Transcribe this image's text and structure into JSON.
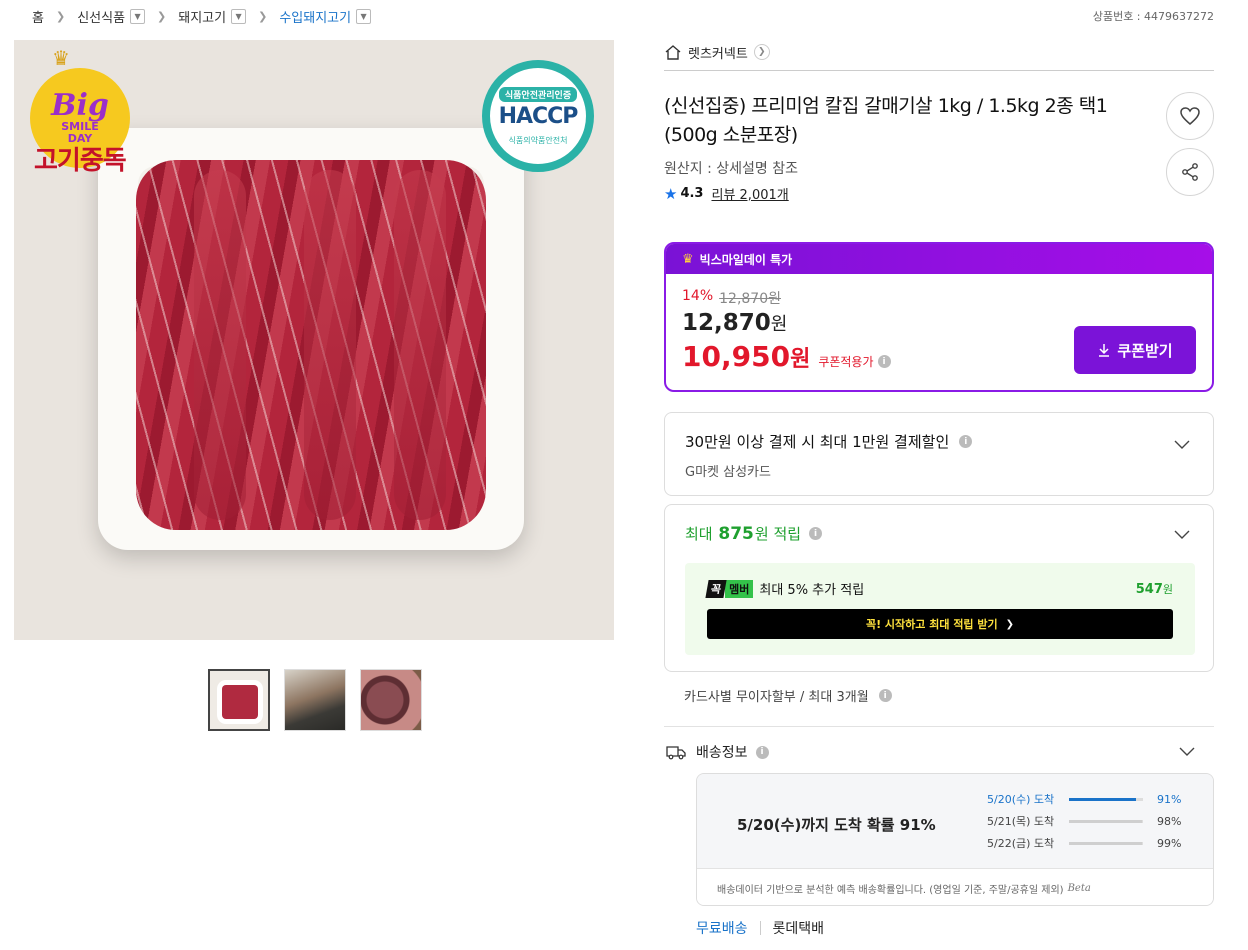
{
  "breadcrumb": {
    "items": [
      {
        "label": "홈"
      },
      {
        "label": "신선식품"
      },
      {
        "label": "돼지고기"
      },
      {
        "label": "수입돼지고기"
      }
    ]
  },
  "product_no": "상품번호 : 4479637272",
  "image": {
    "logo_big": "Big",
    "logo_smile": "SMILE",
    "logo_day": "DAY",
    "logo_brand": "고기중독",
    "haccp_top": "식품안전관리인증",
    "haccp_mid": "HACCP",
    "haccp_bottom": "식품의약품안전처"
  },
  "thumbnails": [
    "thumb-1",
    "thumb-2",
    "thumb-3"
  ],
  "store": {
    "name": "렛츠커넥트"
  },
  "product": {
    "title": "(신선집중) 프리미엄 칼집 갈매기살 1kg / 1.5kg 2종 택1 (500g 소분포장)",
    "origin": "원산지 : 상세설명 참조",
    "rating": "4.3",
    "review_label": "리뷰 2,001개"
  },
  "price": {
    "promo_label": "빅스마일데이 특가",
    "discount_pct": "14%",
    "original": "12,870원",
    "sale_amount": "12,870",
    "sale_unit": "원",
    "coupon_amount": "10,950",
    "coupon_unit": "원",
    "coupon_note": "쿠폰적용가",
    "coupon_button": "쿠폰받기"
  },
  "card_benefit": {
    "title": "30만원 이상 결제 시 최대 1만원 결제할인",
    "subtitle": "G마켓 삼성카드"
  },
  "points": {
    "prefix": "최대",
    "amount": "875",
    "suffix": "원 적립",
    "member_badge_1": "꼭",
    "member_badge_2": "멤버",
    "member_text": "최대 5% 추가 적립",
    "member_amount": "547",
    "member_unit": "원",
    "member_cta": "꼭! 시작하고 최대 적립 받기"
  },
  "installment": "카드사별 무이자할부 / 최대 3개월",
  "shipping": {
    "title": "배송정보",
    "probability_text": "5/20(수)까지 도착 확률 91%",
    "dates": [
      {
        "date": "5/20(수) 도착",
        "pct": "91%",
        "value": 91
      },
      {
        "date": "5/21(목) 도착",
        "pct": "98%",
        "value": 98
      },
      {
        "date": "5/22(금) 도착",
        "pct": "99%",
        "value": 99
      }
    ],
    "note": "배송데이터 기반으로 분석한 예측 배송확률입니다. (영업일 기준, 주말/공휴일 제외)",
    "beta": "Beta",
    "free": "무료배송",
    "carrier": "롯데택배"
  },
  "colors": {
    "accent_purple": "#7b13d8",
    "sale_red": "#e2172b",
    "point_green": "#1fa02f",
    "link_blue": "#1a73c9"
  }
}
